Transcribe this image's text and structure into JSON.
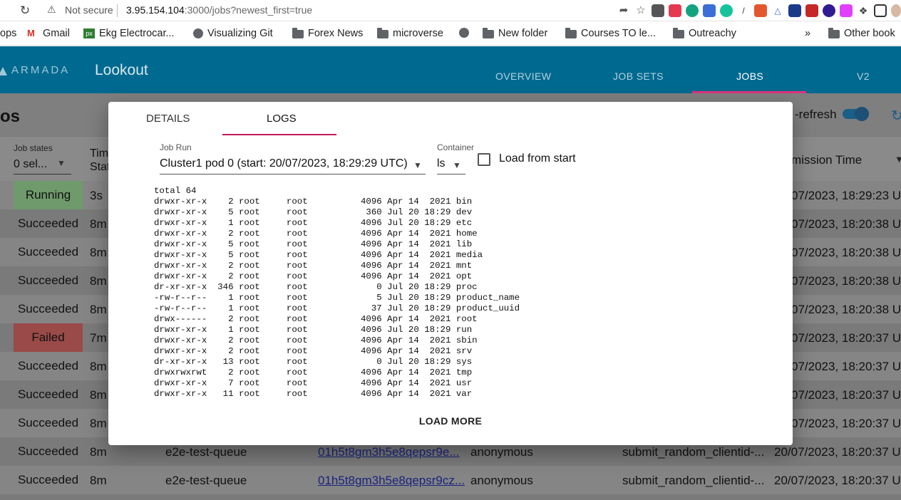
{
  "browser": {
    "reload_icon": "reload-icon",
    "security_label": "Not secure",
    "url_host": "3.95.154.104",
    "url_path": ":3000/jobs?newest_first=true",
    "bookmarks": [
      {
        "label": "ops",
        "icon": "apps-icon"
      },
      {
        "label": "Gmail",
        "icon": "gmail-icon"
      },
      {
        "label": "Ekg Electrocar...",
        "icon": "px-icon"
      },
      {
        "label": "Visualizing Git",
        "icon": "globe-icon"
      },
      {
        "label": "Forex News",
        "icon": "folder-icon"
      },
      {
        "label": "microverse",
        "icon": "folder-icon"
      },
      {
        "label": "",
        "icon": "globe-icon"
      },
      {
        "label": "New folder",
        "icon": "folder-icon"
      },
      {
        "label": "Courses TO le...",
        "icon": "folder-icon"
      },
      {
        "label": "Outreachy",
        "icon": "folder-icon"
      },
      {
        "label": "»",
        "icon": ""
      },
      {
        "label": "Other book",
        "icon": "folder-icon"
      }
    ]
  },
  "app": {
    "logo_text": "ARMADA",
    "title": "Lookout",
    "nav": [
      "OVERVIEW",
      "JOB SETS",
      "JOBS",
      "V2"
    ],
    "active_nav": "JOBS",
    "page_title": "os",
    "autorefresh_label": "-refresh",
    "filters": {
      "job_states_label": "Job states",
      "job_states_value": "0 sel...",
      "time_header_line1": "Tim",
      "time_header_line2": "Stat",
      "submission_header": "mission Time"
    },
    "rows": [
      {
        "state": "Running",
        "time": "3s",
        "queue": "",
        "job_id": "",
        "owner": "",
        "job_set": "",
        "submitted": "07/2023, 18:29:23 UT"
      },
      {
        "state": "Succeeded",
        "time": "8m",
        "queue": "",
        "job_id": "",
        "owner": "",
        "job_set": "",
        "submitted": "07/2023, 18:20:38 UT"
      },
      {
        "state": "Succeeded",
        "time": "8m",
        "queue": "",
        "job_id": "",
        "owner": "",
        "job_set": "",
        "submitted": "07/2023, 18:20:38 UT"
      },
      {
        "state": "Succeeded",
        "time": "8m",
        "queue": "",
        "job_id": "",
        "owner": "",
        "job_set": "",
        "submitted": "07/2023, 18:20:38 UT"
      },
      {
        "state": "Succeeded",
        "time": "8m",
        "queue": "",
        "job_id": "",
        "owner": "",
        "job_set": "",
        "submitted": "07/2023, 18:20:38 UT"
      },
      {
        "state": "Failed",
        "time": "7m",
        "queue": "",
        "job_id": "",
        "owner": "",
        "job_set": "",
        "submitted": "07/2023, 18:20:37 UT"
      },
      {
        "state": "Succeeded",
        "time": "8m",
        "queue": "",
        "job_id": "",
        "owner": "",
        "job_set": "",
        "submitted": "07/2023, 18:20:37 UT"
      },
      {
        "state": "Succeeded",
        "time": "8m",
        "queue": "",
        "job_id": "",
        "owner": "",
        "job_set": "",
        "submitted": "07/2023, 18:20:37 UT"
      },
      {
        "state": "Succeeded",
        "time": "8m",
        "queue": "",
        "job_id": "",
        "owner": "",
        "job_set": "",
        "submitted": "07/2023, 18:20:37 UT"
      },
      {
        "state": "Succeeded",
        "time": "8m",
        "queue": "e2e-test-queue",
        "job_id": "01h5t8gm3h5e8qepsr9e...",
        "owner": "anonymous",
        "job_set": "submit_random_clientid-...",
        "submitted": "20/07/2023, 18:20:37 UT"
      },
      {
        "state": "Succeeded",
        "time": "8m",
        "queue": "e2e-test-queue",
        "job_id": "01h5t8gm3h5e8qepsr9cz...",
        "owner": "anonymous",
        "job_set": "submit_random_clientid-...",
        "submitted": "20/07/2023, 18:20:37 UT"
      }
    ]
  },
  "modal": {
    "tabs": [
      "DETAILS",
      "LOGS"
    ],
    "active_tab": "LOGS",
    "job_run_label": "Job Run",
    "job_run_value": "Cluster1 pod 0 (start: 20/07/2023, 18:29:29 UTC)",
    "container_label": "Container",
    "container_value": "ls",
    "load_from_start_label": "Load from start",
    "load_from_start_checked": false,
    "log_lines": [
      "total 64",
      "drwxr-xr-x    2 root     root          4096 Apr 14  2021 bin",
      "drwxr-xr-x    5 root     root           360 Jul 20 18:29 dev",
      "drwxr-xr-x    1 root     root          4096 Jul 20 18:29 etc",
      "drwxr-xr-x    2 root     root          4096 Apr 14  2021 home",
      "drwxr-xr-x    5 root     root          4096 Apr 14  2021 lib",
      "drwxr-xr-x    5 root     root          4096 Apr 14  2021 media",
      "drwxr-xr-x    2 root     root          4096 Apr 14  2021 mnt",
      "drwxr-xr-x    2 root     root          4096 Apr 14  2021 opt",
      "dr-xr-xr-x  346 root     root             0 Jul 20 18:29 proc",
      "-rw-r--r--    1 root     root             5 Jul 20 18:29 product_name",
      "-rw-r--r--    1 root     root            37 Jul 20 18:29 product_uuid",
      "drwx------    2 root     root          4096 Apr 14  2021 root",
      "drwxr-xr-x    1 root     root          4096 Jul 20 18:29 run",
      "drwxr-xr-x    2 root     root          4096 Apr 14  2021 sbin",
      "drwxr-xr-x    2 root     root          4096 Apr 14  2021 srv",
      "dr-xr-xr-x   13 root     root             0 Jul 20 18:29 sys",
      "drwxrwxrwt    2 root     root          4096 Apr 14  2021 tmp",
      "drwxr-xr-x    7 root     root          4096 Apr 14  2021 usr",
      "drwxr-xr-x   11 root     root          4096 Apr 14  2021 var"
    ],
    "load_more_label": "LOAD MORE"
  },
  "colors": {
    "header_bg": "#00698f",
    "accent_pink": "#e0317e",
    "running": "#6f9a6b",
    "failed": "#9a4a48",
    "link": "#1a237e"
  }
}
